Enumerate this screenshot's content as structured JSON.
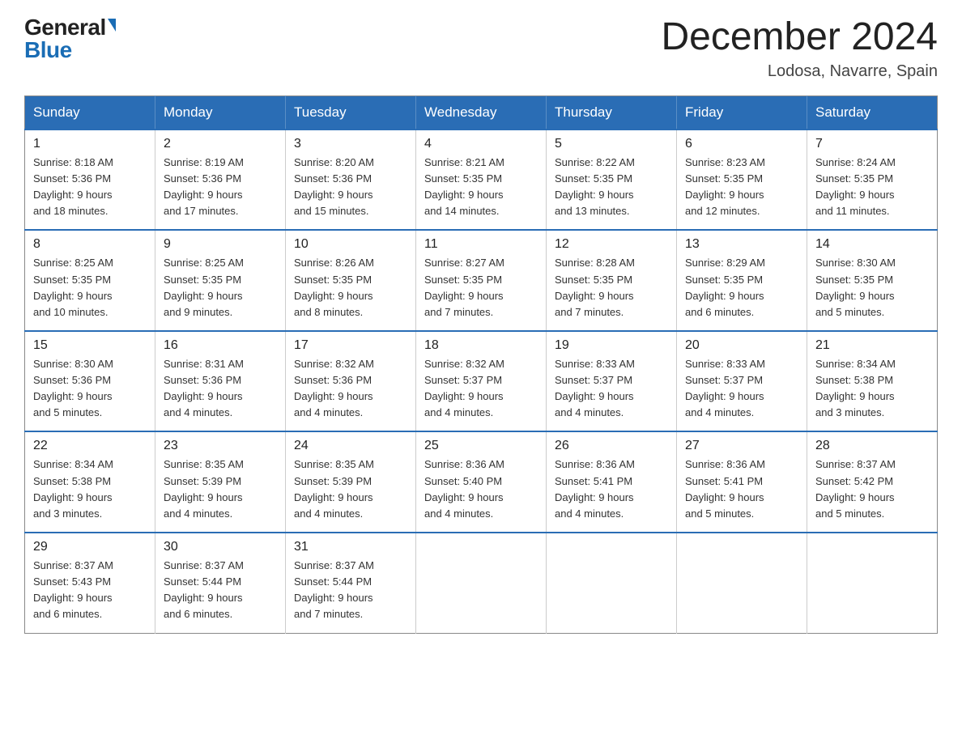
{
  "header": {
    "logo_general": "General",
    "logo_blue": "Blue",
    "month_title": "December 2024",
    "location": "Lodosa, Navarre, Spain"
  },
  "days_of_week": [
    "Sunday",
    "Monday",
    "Tuesday",
    "Wednesday",
    "Thursday",
    "Friday",
    "Saturday"
  ],
  "weeks": [
    [
      {
        "day": "1",
        "sunrise": "8:18 AM",
        "sunset": "5:36 PM",
        "daylight": "9 hours and 18 minutes."
      },
      {
        "day": "2",
        "sunrise": "8:19 AM",
        "sunset": "5:36 PM",
        "daylight": "9 hours and 17 minutes."
      },
      {
        "day": "3",
        "sunrise": "8:20 AM",
        "sunset": "5:36 PM",
        "daylight": "9 hours and 15 minutes."
      },
      {
        "day": "4",
        "sunrise": "8:21 AM",
        "sunset": "5:35 PM",
        "daylight": "9 hours and 14 minutes."
      },
      {
        "day": "5",
        "sunrise": "8:22 AM",
        "sunset": "5:35 PM",
        "daylight": "9 hours and 13 minutes."
      },
      {
        "day": "6",
        "sunrise": "8:23 AM",
        "sunset": "5:35 PM",
        "daylight": "9 hours and 12 minutes."
      },
      {
        "day": "7",
        "sunrise": "8:24 AM",
        "sunset": "5:35 PM",
        "daylight": "9 hours and 11 minutes."
      }
    ],
    [
      {
        "day": "8",
        "sunrise": "8:25 AM",
        "sunset": "5:35 PM",
        "daylight": "9 hours and 10 minutes."
      },
      {
        "day": "9",
        "sunrise": "8:25 AM",
        "sunset": "5:35 PM",
        "daylight": "9 hours and 9 minutes."
      },
      {
        "day": "10",
        "sunrise": "8:26 AM",
        "sunset": "5:35 PM",
        "daylight": "9 hours and 8 minutes."
      },
      {
        "day": "11",
        "sunrise": "8:27 AM",
        "sunset": "5:35 PM",
        "daylight": "9 hours and 7 minutes."
      },
      {
        "day": "12",
        "sunrise": "8:28 AM",
        "sunset": "5:35 PM",
        "daylight": "9 hours and 7 minutes."
      },
      {
        "day": "13",
        "sunrise": "8:29 AM",
        "sunset": "5:35 PM",
        "daylight": "9 hours and 6 minutes."
      },
      {
        "day": "14",
        "sunrise": "8:30 AM",
        "sunset": "5:35 PM",
        "daylight": "9 hours and 5 minutes."
      }
    ],
    [
      {
        "day": "15",
        "sunrise": "8:30 AM",
        "sunset": "5:36 PM",
        "daylight": "9 hours and 5 minutes."
      },
      {
        "day": "16",
        "sunrise": "8:31 AM",
        "sunset": "5:36 PM",
        "daylight": "9 hours and 4 minutes."
      },
      {
        "day": "17",
        "sunrise": "8:32 AM",
        "sunset": "5:36 PM",
        "daylight": "9 hours and 4 minutes."
      },
      {
        "day": "18",
        "sunrise": "8:32 AM",
        "sunset": "5:37 PM",
        "daylight": "9 hours and 4 minutes."
      },
      {
        "day": "19",
        "sunrise": "8:33 AM",
        "sunset": "5:37 PM",
        "daylight": "9 hours and 4 minutes."
      },
      {
        "day": "20",
        "sunrise": "8:33 AM",
        "sunset": "5:37 PM",
        "daylight": "9 hours and 4 minutes."
      },
      {
        "day": "21",
        "sunrise": "8:34 AM",
        "sunset": "5:38 PM",
        "daylight": "9 hours and 3 minutes."
      }
    ],
    [
      {
        "day": "22",
        "sunrise": "8:34 AM",
        "sunset": "5:38 PM",
        "daylight": "9 hours and 3 minutes."
      },
      {
        "day": "23",
        "sunrise": "8:35 AM",
        "sunset": "5:39 PM",
        "daylight": "9 hours and 4 minutes."
      },
      {
        "day": "24",
        "sunrise": "8:35 AM",
        "sunset": "5:39 PM",
        "daylight": "9 hours and 4 minutes."
      },
      {
        "day": "25",
        "sunrise": "8:36 AM",
        "sunset": "5:40 PM",
        "daylight": "9 hours and 4 minutes."
      },
      {
        "day": "26",
        "sunrise": "8:36 AM",
        "sunset": "5:41 PM",
        "daylight": "9 hours and 4 minutes."
      },
      {
        "day": "27",
        "sunrise": "8:36 AM",
        "sunset": "5:41 PM",
        "daylight": "9 hours and 5 minutes."
      },
      {
        "day": "28",
        "sunrise": "8:37 AM",
        "sunset": "5:42 PM",
        "daylight": "9 hours and 5 minutes."
      }
    ],
    [
      {
        "day": "29",
        "sunrise": "8:37 AM",
        "sunset": "5:43 PM",
        "daylight": "9 hours and 6 minutes."
      },
      {
        "day": "30",
        "sunrise": "8:37 AM",
        "sunset": "5:44 PM",
        "daylight": "9 hours and 6 minutes."
      },
      {
        "day": "31",
        "sunrise": "8:37 AM",
        "sunset": "5:44 PM",
        "daylight": "9 hours and 7 minutes."
      },
      null,
      null,
      null,
      null
    ]
  ],
  "labels": {
    "sunrise": "Sunrise:",
    "sunset": "Sunset:",
    "daylight": "Daylight:"
  }
}
